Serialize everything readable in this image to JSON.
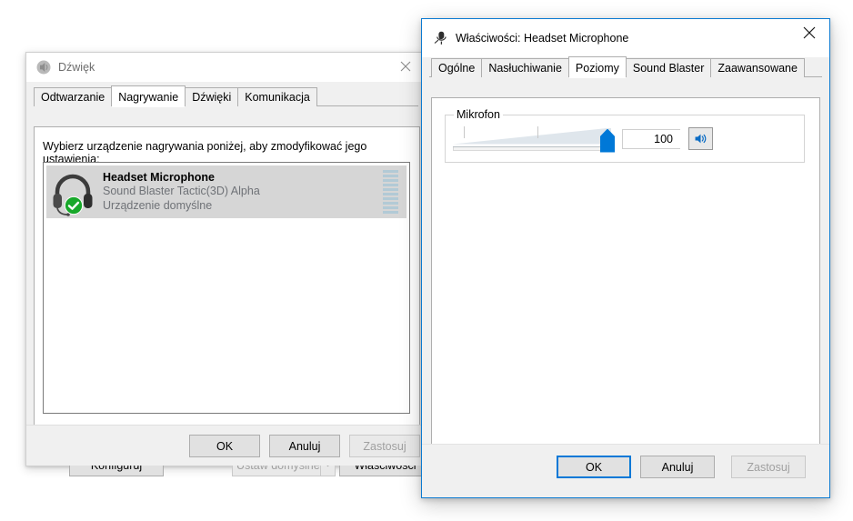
{
  "sound_dialog": {
    "title": "Dźwięk",
    "title_icon": "speaker-icon",
    "close_icon": "close-icon",
    "tabs": [
      {
        "label": "Odtwarzanie",
        "active": false
      },
      {
        "label": "Nagrywanie",
        "active": true
      },
      {
        "label": "Dźwięki",
        "active": false
      },
      {
        "label": "Komunikacja",
        "active": false
      }
    ],
    "hint": "Wybierz urządzenie nagrywania poniżej, aby zmodyfikować jego ustawienia:",
    "devices": [
      {
        "name": "Headset Microphone",
        "driver": "Sound Blaster Tactic(3D) Alpha",
        "status": "Urządzenie domyślne",
        "icon": "headset-icon",
        "badge_icon": "green-check-icon",
        "selected": true,
        "meter_segments": 10
      }
    ],
    "buttons": {
      "configure": "Konfiguruj",
      "set_default": "Ustaw domyślne",
      "set_default_arrow_icon": "chevron-down-icon",
      "properties": "Właściwości",
      "ok": "OK",
      "cancel": "Anuluj",
      "apply": "Zastosuj"
    }
  },
  "properties_dialog": {
    "title": "Właściwości: Headset Microphone",
    "title_icon": "microphone-icon",
    "close_icon": "close-icon",
    "tabs": [
      {
        "label": "Ogólne",
        "active": false
      },
      {
        "label": "Nasłuchiwanie",
        "active": false
      },
      {
        "label": "Poziomy",
        "active": true
      },
      {
        "label": "Sound Blaster",
        "active": false
      },
      {
        "label": "Zaawansowane",
        "active": false
      }
    ],
    "level_group": {
      "title": "Mikrofon",
      "value": "100",
      "mute_icon": "speaker-on-icon"
    },
    "buttons": {
      "ok": "OK",
      "cancel": "Anuluj",
      "apply": "Zastosuj"
    }
  },
  "colors": {
    "accent": "#0078d7",
    "active_border": "#0b7ad1",
    "selection": "#d6d6d6",
    "meter": "#b2cad6",
    "default_badge": "#1aab29"
  }
}
